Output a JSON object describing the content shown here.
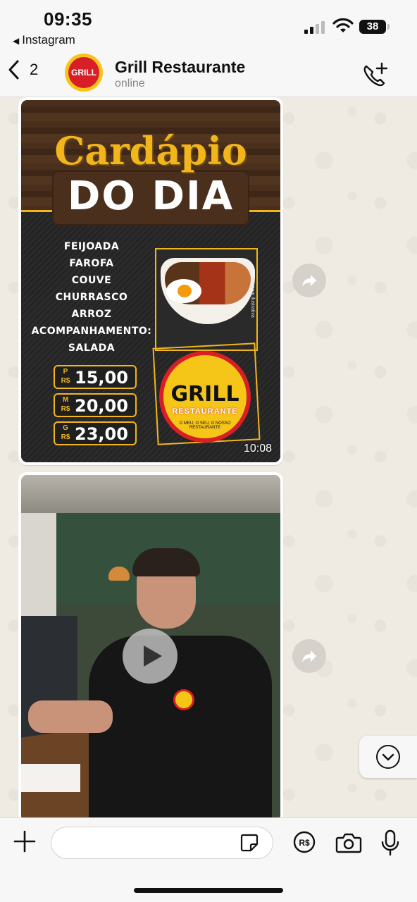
{
  "status_bar": {
    "time": "09:35",
    "back_app": "Instagram",
    "battery": "38",
    "battery_level": 0.38
  },
  "header": {
    "back_count": "2",
    "contact_name": "Grill Restaurante",
    "contact_status": "online",
    "avatar_text": "GRILL"
  },
  "messages": [
    {
      "type": "image",
      "poster": {
        "title": "Cardápio",
        "subtitle": "DO DIA",
        "menu_items": [
          "FEIJOADA",
          "FAROFA",
          "COUVE",
          "CHURRASCO",
          "ARROZ",
          "ACOMPANHAMENTO:",
          "SALADA"
        ],
        "image_caption": "Imagem ilustrativa",
        "prices": [
          {
            "size": "P",
            "currency": "R$",
            "value": "15,00"
          },
          {
            "size": "M",
            "currency": "R$",
            "value": "20,00"
          },
          {
            "size": "G",
            "currency": "R$",
            "value": "23,00"
          }
        ],
        "logo_name": "GRILL",
        "logo_sub": "RESTAURANTE",
        "logo_tagline": "O MEU, O SEU, O NOSSO RESTAURANTE"
      },
      "time": "10:08"
    },
    {
      "type": "video",
      "shirt_logo": "GRILL"
    }
  ],
  "composer": {
    "placeholder": ""
  },
  "colors": {
    "accent_yellow": "#f2b51b",
    "brand_red": "#d81f26",
    "wallpaper": "#efeae2"
  },
  "icons": {
    "back": "chevron-left-icon",
    "call_add": "phone-plus-icon",
    "forward": "forward-arrow-icon",
    "scroll_down": "chevron-down-circle-icon",
    "attach": "plus-icon",
    "sticker": "sticker-icon",
    "payment": "payment-icon",
    "camera": "camera-icon",
    "mic": "microphone-icon"
  }
}
